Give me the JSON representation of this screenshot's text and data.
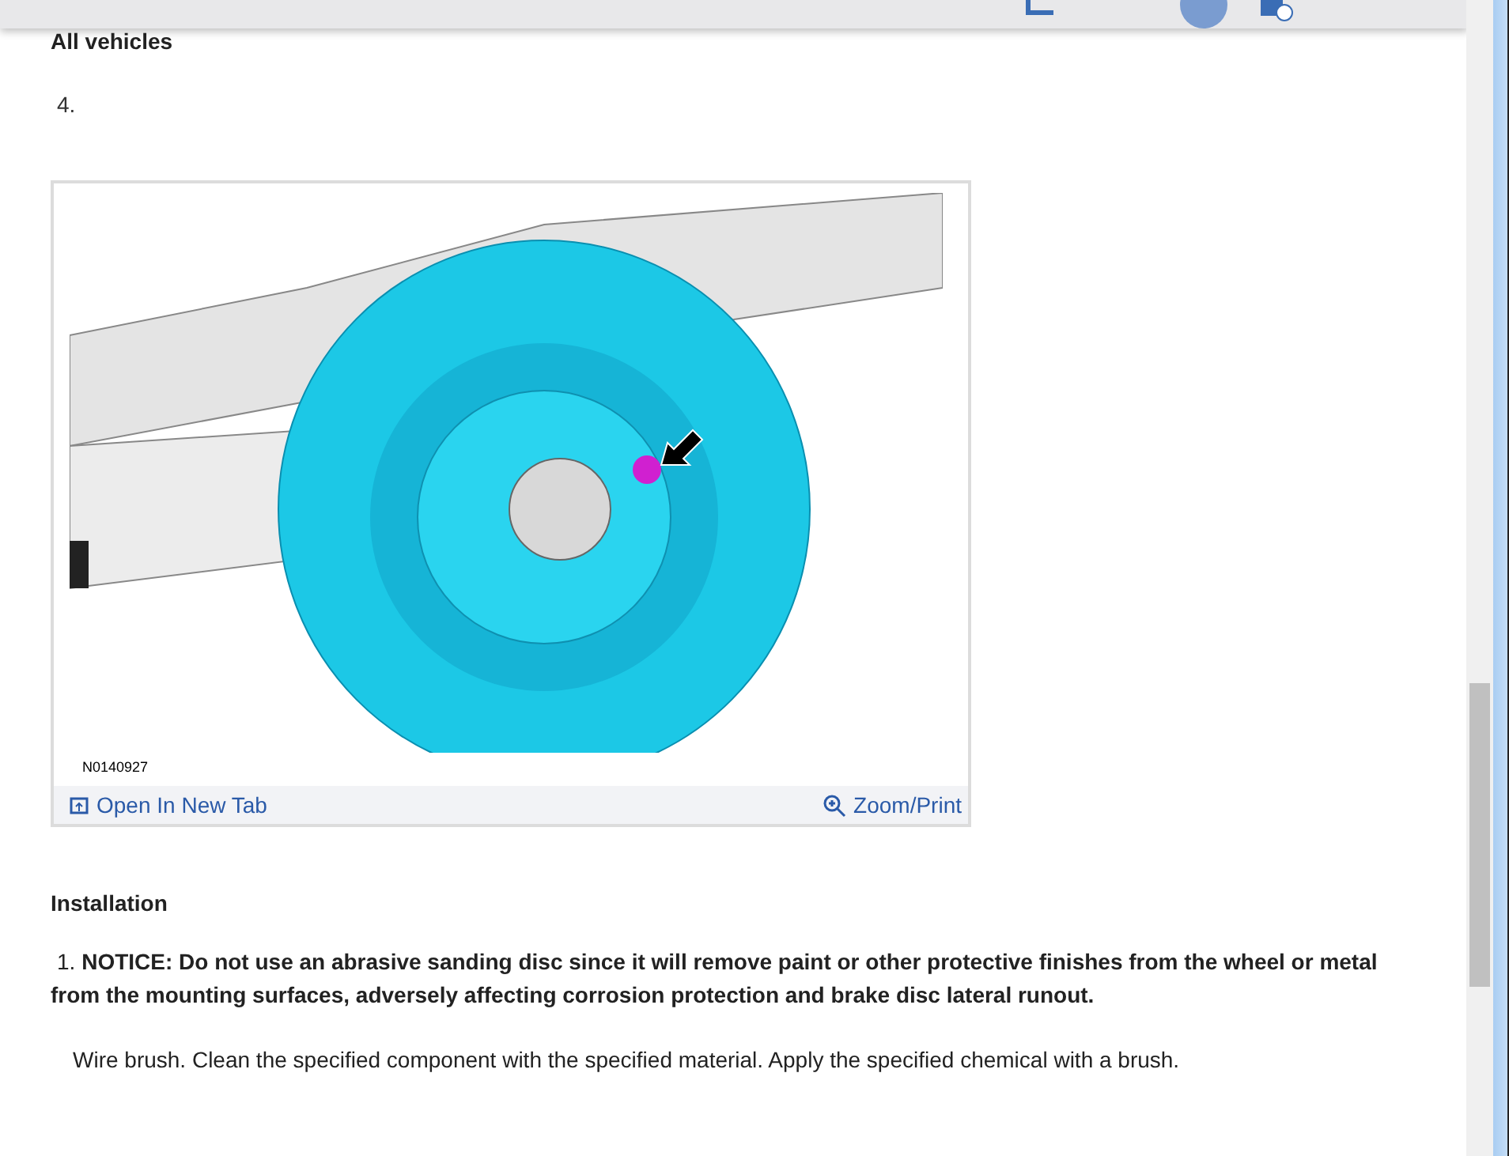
{
  "section_title": "All vehicles",
  "step_number": "4.",
  "figure": {
    "caption": "N0140927",
    "open_link": "Open In New Tab",
    "zoom_link": "Zoom/Print"
  },
  "installation": {
    "title": "Installation",
    "steps": [
      {
        "number": "1.",
        "notice": "**NOTICE: Do not use an abrasive sanding disc since it will remove paint or other protective finishes from the wheel or metal from the mounting surfaces, adversely affecting corrosion protection and brake disc lateral runout.**",
        "detail": "Wire brush. Clean the specified component with the specified material. Apply the specified chemical with a brush."
      }
    ]
  }
}
